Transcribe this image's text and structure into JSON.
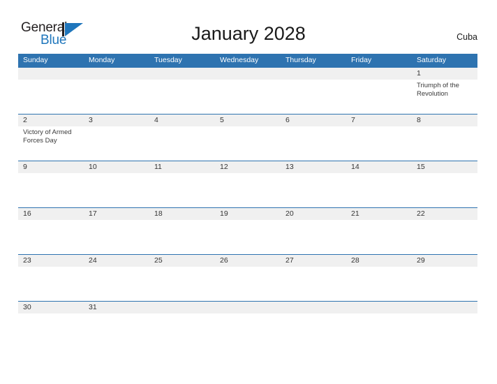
{
  "brand": {
    "word_one": "General",
    "word_two": "Blue",
    "mark_icon": "general-blue-triangle-logo",
    "accent_color": "#1f76bc",
    "dark_color": "#231f20"
  },
  "header": {
    "title": "January 2028",
    "country": "Cuba"
  },
  "theme": {
    "header_blue": "#2e73b0",
    "band_gray": "#f0f0f0",
    "text_dark": "#333333",
    "page_background": "#ffffff"
  },
  "calendar": {
    "day_headers": [
      "Sunday",
      "Monday",
      "Tuesday",
      "Wednesday",
      "Thursday",
      "Friday",
      "Saturday"
    ],
    "weeks": [
      {
        "dates": [
          "",
          "",
          "",
          "",
          "",
          "",
          "1"
        ],
        "events": [
          "",
          "",
          "",
          "",
          "",
          "",
          "Triumph of the Revolution"
        ]
      },
      {
        "dates": [
          "2",
          "3",
          "4",
          "5",
          "6",
          "7",
          "8"
        ],
        "events": [
          "Victory of Armed Forces Day",
          "",
          "",
          "",
          "",
          "",
          ""
        ]
      },
      {
        "dates": [
          "9",
          "10",
          "11",
          "12",
          "13",
          "14",
          "15"
        ],
        "events": [
          "",
          "",
          "",
          "",
          "",
          "",
          ""
        ]
      },
      {
        "dates": [
          "16",
          "17",
          "18",
          "19",
          "20",
          "21",
          "22"
        ],
        "events": [
          "",
          "",
          "",
          "",
          "",
          "",
          ""
        ]
      },
      {
        "dates": [
          "23",
          "24",
          "25",
          "26",
          "27",
          "28",
          "29"
        ],
        "events": [
          "",
          "",
          "",
          "",
          "",
          "",
          ""
        ]
      },
      {
        "dates": [
          "30",
          "31",
          "",
          "",
          "",
          "",
          ""
        ],
        "events": [
          "",
          "",
          "",
          "",
          "",
          "",
          ""
        ]
      }
    ]
  }
}
